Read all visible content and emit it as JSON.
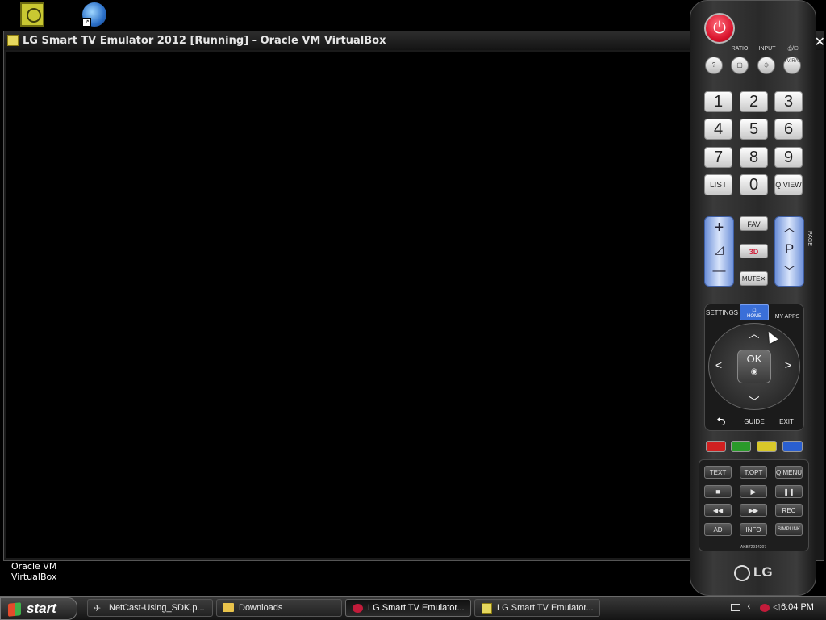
{
  "desktop": {
    "icons": [
      {
        "name": "Oracle VM VirtualBox",
        "icon": "virtualbox-icon"
      },
      {
        "name": "",
        "icon": "browser-icon"
      }
    ],
    "vbox_label": "Oracle VM\nVirtualBox"
  },
  "window": {
    "title": "LG Smart TV Emulator 2012 [Running] - Oracle VM VirtualBox",
    "close": "✕"
  },
  "remote": {
    "labels": {
      "ratio": "RATIO",
      "input": "INPUT",
      "tvrad_label": "⎙/▢"
    },
    "top_buttons": [
      "?",
      "▢",
      "⎆",
      "TV/RAD"
    ],
    "numbers": [
      "1",
      "2",
      "3",
      "4",
      "5",
      "6",
      "7",
      "8",
      "9"
    ],
    "list": "LIST",
    "zero": "0",
    "qview": "Q.VIEW",
    "vol_plus": "+",
    "vol_sym": "◿",
    "vol_minus": "—",
    "fav": "FAV",
    "three_d": "3D",
    "mute": "MUTE✕",
    "ch_up": "︿",
    "ch_p": "P",
    "ch_down": "﹀",
    "page": "PAGE",
    "settings": "SETTINGS",
    "home": "HOME",
    "my_apps": "MY APPS",
    "up": "︿",
    "left": "<",
    "ok": "OK",
    "right": ">",
    "down": "﹀",
    "back": "⮌",
    "guide": "GUIDE",
    "exit": "EXIT",
    "color_buttons": [
      {
        "color": "#d02020"
      },
      {
        "color": "#2a9a2a"
      },
      {
        "color": "#d8c82a"
      },
      {
        "color": "#2a5fd0"
      }
    ],
    "text": "TEXT",
    "topt": "T.OPT",
    "qmenu": "Q.MENU",
    "stop": "■",
    "play": "▶",
    "pause": "❚❚",
    "rew": "◀◀",
    "ff": "▶▶",
    "rec": "REC",
    "ad": "AD",
    "info": "INFO",
    "simplink": "SIMPLINK",
    "model": "AKB72914207",
    "brand": "LG"
  },
  "taskbar": {
    "start": "start",
    "tasks": [
      {
        "label": "NetCast-Using_SDK.p...",
        "icon": "pdf-icon",
        "active": false
      },
      {
        "label": "Downloads",
        "icon": "folder-icon",
        "active": false
      },
      {
        "label": "LG Smart TV Emulator...",
        "icon": "lg-icon",
        "active": true
      },
      {
        "label": "LG Smart TV Emulator...",
        "icon": "virtualbox-icon",
        "active": false
      }
    ],
    "clock": "6:04 PM"
  },
  "colors": {
    "accent": "#3a6fd8",
    "power": "#e0253b",
    "taskbar": "#1d1d1d"
  }
}
